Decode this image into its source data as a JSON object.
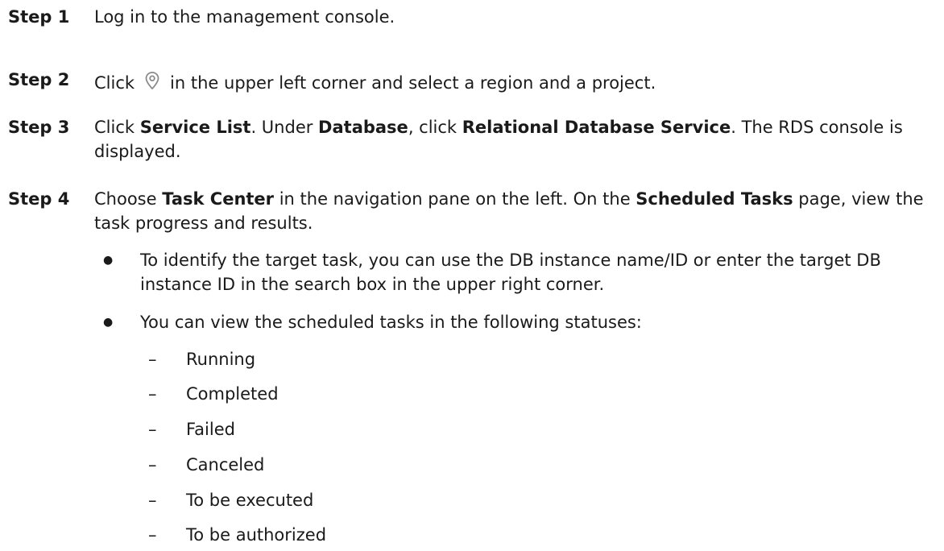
{
  "steps": [
    {
      "label": "Step 1",
      "text": "Log in to the management console."
    },
    {
      "label": "Step 2",
      "text_a": "Click",
      "icon": "location-pin-icon",
      "text_b": "in the upper left corner and select a region and a project."
    },
    {
      "label": "Step 3",
      "t1": "Click ",
      "b1": "Service List",
      "t2": ". Under ",
      "b2": "Database",
      "t3": ", click ",
      "b3": "Relational Database Service",
      "t4": ". The RDS console is displayed."
    },
    {
      "label": "Step 4",
      "t1": "Choose ",
      "b1": "Task Center",
      "t2": " in the navigation pane on the left. On the ",
      "b2": "Scheduled Tasks",
      "t3": " page, view the task progress and results.",
      "bullets": [
        "To identify the target task, you can use the DB instance name/ID or enter the target DB instance ID in the search box in the upper right corner.",
        "You can view the scheduled tasks in the following statuses:"
      ],
      "bullet_symbol": "●",
      "dash_symbol": "–",
      "statuses": [
        "Running",
        "Completed",
        "Failed",
        "Canceled",
        "To be executed",
        "To be authorized"
      ]
    }
  ]
}
